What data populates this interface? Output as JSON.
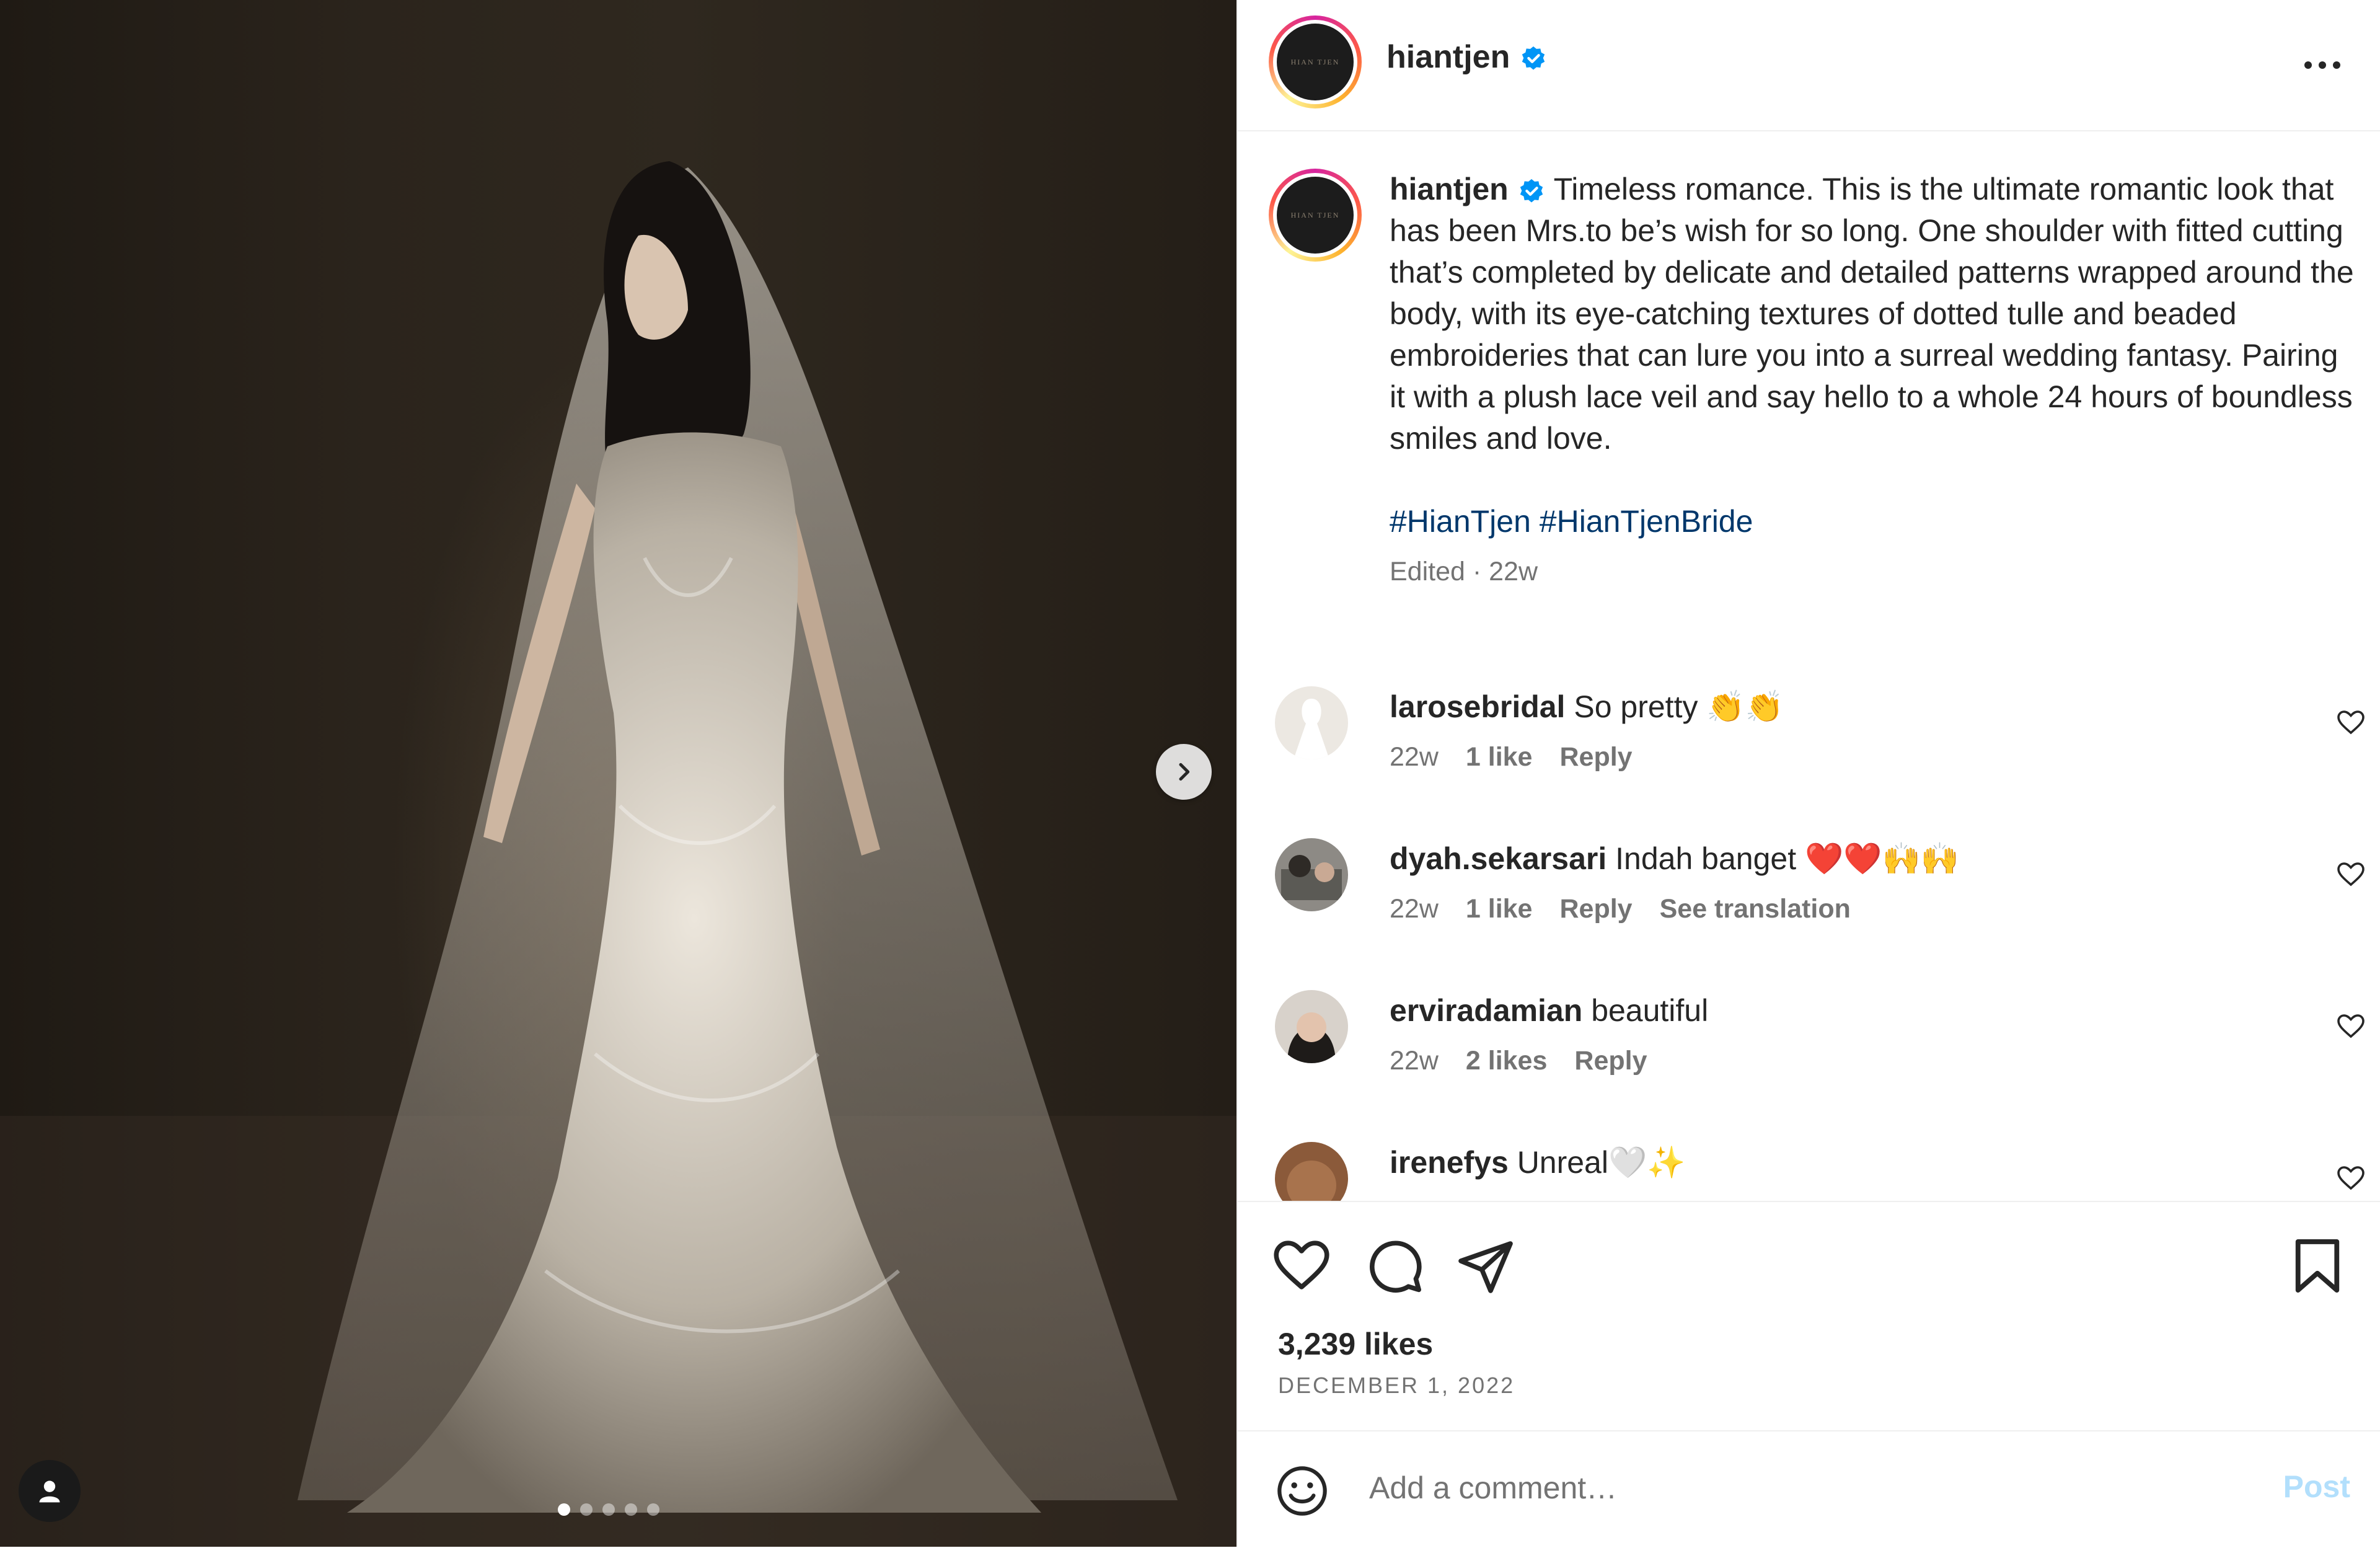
{
  "post": {
    "author": "hiantjen",
    "avatar_text": "HIAN TJEN",
    "verified_icon": "verified-badge-icon",
    "caption": "Timeless romance. This is the ultimate romantic look that has been Mrs.to be’s wish for so long. One shoulder with fitted cutting that’s completed by delicate and detailed patterns wrapped around the body, with its eye-catching textures of dotted tulle and beaded embroideries that can lure you into a surreal wedding fantasy. Pairing it with a plush lace veil and say hello to a whole 24 hours of boundless smiles and love.",
    "hashtags": "#HianTjen #HianTjenBride",
    "meta": "Edited · 22w",
    "likes": "3,239 likes",
    "date": "DECEMBER 1, 2022"
  },
  "carousel": {
    "total": 5,
    "active": 1
  },
  "comments": [
    {
      "user": "larosebridal",
      "text": "So pretty 👏👏",
      "age": "22w",
      "likes": "1 like",
      "reply": "Reply",
      "extra": ""
    },
    {
      "user": "dyah.sekarsari",
      "text": "Indah banget ❤️❤️🙌🙌",
      "age": "22w",
      "likes": "1 like",
      "reply": "Reply",
      "extra": "See translation"
    },
    {
      "user": "erviradamian",
      "text": "beautiful",
      "age": "22w",
      "likes": "2 likes",
      "reply": "Reply",
      "extra": ""
    },
    {
      "user": "irenefys",
      "text": "Unreal🤍✨",
      "age": "",
      "likes": "",
      "reply": "",
      "extra": ""
    }
  ],
  "composer": {
    "placeholder": "Add a comment…",
    "post_label": "Post"
  },
  "colors": {
    "link": "#00376b",
    "muted": "#737373",
    "post_disabled": "#b2dffc",
    "verified": "#0095f6"
  }
}
